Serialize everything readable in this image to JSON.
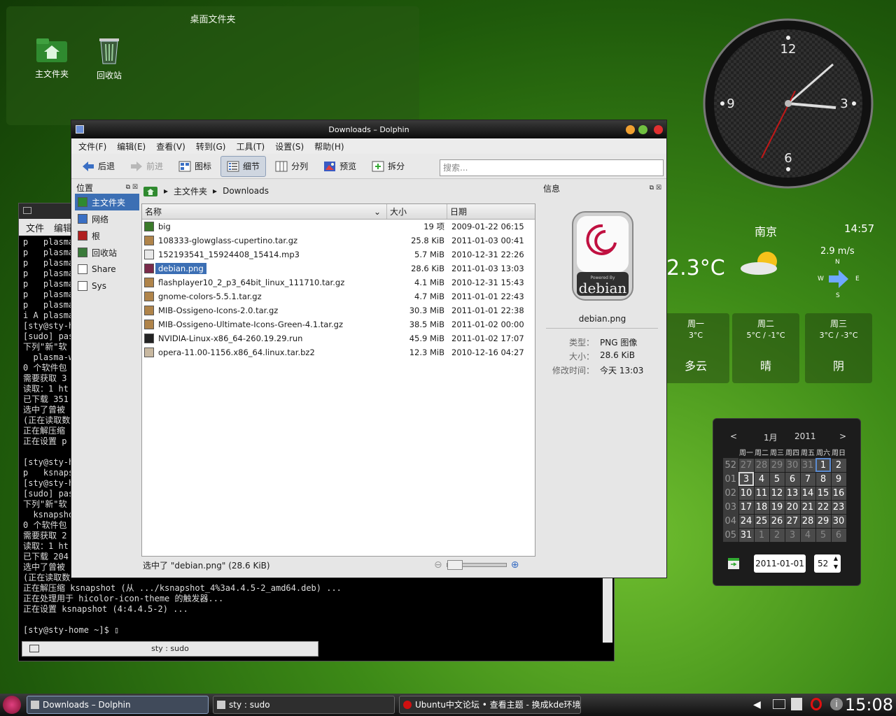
{
  "desktop_folder": {
    "title": "桌面文件夹",
    "icons": [
      {
        "label": "主文件夹",
        "icon": "home-folder-icon"
      },
      {
        "label": "回收站",
        "icon": "trash-icon"
      }
    ]
  },
  "clock_widget": {
    "numerals": [
      "12",
      "3",
      "6",
      "9"
    ],
    "time": "15:08"
  },
  "weather": {
    "city": "南京",
    "time": "14:57",
    "temperature": "2.3°C",
    "wind_speed": "2.9 m/s",
    "compass": {
      "n": "N",
      "e": "E",
      "s": "S",
      "w": "W"
    },
    "forecast": [
      {
        "day": "周一",
        "temp": "3°C",
        "condition": "多云"
      },
      {
        "day": "周二",
        "temp": "5°C / -1°C",
        "condition": "晴"
      },
      {
        "day": "周三",
        "temp": "3°C / -3°C",
        "condition": "阴"
      }
    ]
  },
  "calendar": {
    "prev": "<",
    "next": ">",
    "month": "1月",
    "year": "2011",
    "weekdays": [
      "周一",
      "周二",
      "周三",
      "周四",
      "周五",
      "周六",
      "周日"
    ],
    "weeks": [
      {
        "num": "52",
        "days": [
          "27",
          "28",
          "29",
          "30",
          "31",
          "1",
          "2"
        ]
      },
      {
        "num": "01",
        "days": [
          "3",
          "4",
          "5",
          "6",
          "7",
          "8",
          "9"
        ]
      },
      {
        "num": "02",
        "days": [
          "10",
          "11",
          "12",
          "13",
          "14",
          "15",
          "16"
        ]
      },
      {
        "num": "03",
        "days": [
          "17",
          "18",
          "19",
          "20",
          "21",
          "22",
          "23"
        ]
      },
      {
        "num": "04",
        "days": [
          "24",
          "25",
          "26",
          "27",
          "28",
          "29",
          "30"
        ]
      },
      {
        "num": "05",
        "days": [
          "31",
          "1",
          "2",
          "3",
          "4",
          "5",
          "6"
        ]
      }
    ],
    "date_input": "2011-01-01",
    "week_input": "52"
  },
  "terminal": {
    "menu": [
      "文件",
      "编辑"
    ],
    "lines": [
      "p   plasma",
      "p   plasma",
      "p   plasma",
      "p   plasma",
      "p   plasma",
      "p   plasma",
      "p   plasma",
      "i A plasma",
      "[sty@sty-h",
      "[sudo] pas",
      "下列\"新\"软",
      "  plasma-w",
      "0 个软件包",
      "需要获取 3",
      "读取：1 ht",
      "已下载 351",
      "选中了曾被",
      "(正在读取数",
      "正在解压缩",
      "正在设置 p",
      "",
      "[sty@sty-h",
      "p   ksnaps",
      "[sty@sty-h",
      "[sudo] pas",
      "下列\"新\"软",
      "  ksnapsho",
      "0 个软件包",
      "需要获取 2",
      "读取：1 ht",
      "已下载 204",
      "选中了曾被",
      "(正在读取数",
      "正在解压缩 ksnapshot (从 .../ksnapshot_4%3a4.4.5-2_amd64.deb) ...",
      "正在处理用于 hicolor-icon-theme 的触发器...",
      "正在设置 ksnapshot (4:4.4.5-2) ...",
      "",
      "[sty@sty-home ~]$ ▯"
    ],
    "tab_label": "sty : sudo"
  },
  "dolphin": {
    "title": "Downloads – Dolphin",
    "menu": [
      "文件(F)",
      "编辑(E)",
      "查看(V)",
      "转到(G)",
      "工具(T)",
      "设置(S)",
      "帮助(H)"
    ],
    "toolbar": {
      "back": "后退",
      "forward": "前进",
      "icons": "图标",
      "details": "细节",
      "columns": "分列",
      "preview": "预览",
      "split": "拆分"
    },
    "search_placeholder": "搜索...",
    "places": {
      "title": "位置",
      "items": [
        {
          "label": "主文件夹",
          "icon": "home-icon"
        },
        {
          "label": "网络",
          "icon": "network-icon"
        },
        {
          "label": "根",
          "icon": "root-folder-icon"
        },
        {
          "label": "回收站",
          "icon": "trash-icon"
        },
        {
          "label": "Share",
          "icon": "drive-icon"
        },
        {
          "label": "Sys",
          "icon": "drive-icon"
        }
      ]
    },
    "breadcrumb": [
      "主文件夹",
      "Downloads"
    ],
    "columns": [
      "名称",
      "大小",
      "日期"
    ],
    "files": [
      {
        "name": "big",
        "size": "19 项",
        "date": "2009-01-22 06:15",
        "color": "#3a7a2a"
      },
      {
        "name": "108333-glowglass-cupertino.tar.gz",
        "size": "25.8 KiB",
        "date": "2011-01-03 00:41",
        "color": "#b0844a"
      },
      {
        "name": "152193541_15924408_15414.mp3",
        "size": "5.7 MiB",
        "date": "2010-12-31 22:26",
        "color": "#e8e8e8"
      },
      {
        "name": "debian.png",
        "size": "28.6 KiB",
        "date": "2011-01-03 13:03",
        "color": "#7a2a4a"
      },
      {
        "name": "flashplayer10_2_p3_64bit_linux_111710.tar.gz",
        "size": "4.1 MiB",
        "date": "2010-12-31 15:43",
        "color": "#b0844a"
      },
      {
        "name": "gnome-colors-5.5.1.tar.gz",
        "size": "4.7 MiB",
        "date": "2011-01-01 22:43",
        "color": "#b0844a"
      },
      {
        "name": "MIB-Ossigeno-Icons-2.0.tar.gz",
        "size": "30.3 MiB",
        "date": "2011-01-01 22:38",
        "color": "#b0844a"
      },
      {
        "name": "MIB-Ossigeno-Ultimate-Icons-Green-4.1.tar.gz",
        "size": "38.5 MiB",
        "date": "2011-01-02 00:00",
        "color": "#b0844a"
      },
      {
        "name": "NVIDIA-Linux-x86_64-260.19.29.run",
        "size": "45.9 MiB",
        "date": "2011-01-02 17:07",
        "color": "#222222"
      },
      {
        "name": "opera-11.00-1156.x86_64.linux.tar.bz2",
        "size": "12.3 MiB",
        "date": "2010-12-16 04:27",
        "color": "#c8b8a0"
      }
    ],
    "selected_index": 3,
    "status": "选中了 \"debian.png\" (28.6 KiB)",
    "info": {
      "title": "信息",
      "preview_text": "debian",
      "preview_subtext": "Powered By",
      "filename": "debian.png",
      "rows": [
        {
          "key": "类型：",
          "value": "PNG 图像"
        },
        {
          "key": "大小：",
          "value": "28.6 KiB"
        },
        {
          "key": "修改时间：",
          "value": "今天 13:03"
        }
      ]
    }
  },
  "taskbar": {
    "tasks": [
      {
        "label": "Downloads – Dolphin",
        "active": true
      },
      {
        "label": "sty : sudo",
        "active": false
      },
      {
        "label": "Ubuntu中文论坛 • 查看主题 - 换成kde环境的",
        "active": false
      }
    ],
    "clock": "15:08"
  }
}
